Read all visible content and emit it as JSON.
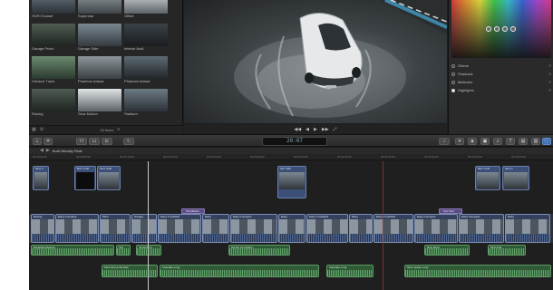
{
  "browser": {
    "clips": [
      {
        "label": "HDRI Sunset"
      },
      {
        "label": "Superstar"
      },
      {
        "label": "Offset"
      },
      {
        "label": "Garage Front"
      },
      {
        "label": "Garage Side"
      },
      {
        "label": "Interior Audi"
      },
      {
        "label": "Outdoor Track"
      },
      {
        "label": "Phantom Ahead"
      },
      {
        "label": "Phantom Ahead"
      },
      {
        "label": "Racing"
      },
      {
        "label": "Slow Motion"
      },
      {
        "label": "Stadium"
      }
    ],
    "count_label": "18 items"
  },
  "viewer": {
    "controls": [
      "◀◀",
      "◀",
      "▶",
      "▶▶",
      "⤢"
    ]
  },
  "inspector": {
    "corrections": [
      {
        "label": "Global",
        "selected": false
      },
      {
        "label": "Shadows",
        "selected": false
      },
      {
        "label": "Midtones",
        "selected": false
      },
      {
        "label": "Highlights",
        "selected": true
      }
    ]
  },
  "toolbar": {
    "timecode": "20:07"
  },
  "timeline": {
    "project_title": "Audi Velocity Final",
    "ruler_ticks": [
      "00:00:00:00",
      "00:00:05:00",
      "00:00:10:00",
      "00:00:15:00",
      "00:00:20:00",
      "00:00:25:00",
      "00:00:30:00",
      "00:00:35:00",
      "00:00:40:00",
      "00:00:45:00",
      "00:00:50:00",
      "00:00:55:00"
    ],
    "connected_clips": [
      {
        "label": "SLO 2"
      },
      {
        "label": "BAY CAR"
      },
      {
        "label": "SLO CAR"
      },
      {
        "label": "SKY 360"
      },
      {
        "label": "BAY CAR"
      },
      {
        "label": "SLO 2"
      }
    ],
    "titles": [
      {
        "label": "Text Below"
      },
      {
        "label": "Text Text"
      }
    ],
    "primary_clips": [
      {
        "label": "Racing"
      },
      {
        "label": "Early Compass"
      },
      {
        "label": "Slow"
      },
      {
        "label": "Garage"
      },
      {
        "label": "Early Crossfield"
      },
      {
        "label": "Early"
      },
      {
        "label": "Early Compass"
      },
      {
        "label": "Early"
      },
      {
        "label": "Early Crossfield"
      },
      {
        "label": "Early"
      },
      {
        "label": "Early Crossfield"
      },
      {
        "label": "Early Compass"
      },
      {
        "label": "Early Compass"
      },
      {
        "label": "Early"
      }
    ],
    "audio_clips": [
      {
        "label": "Breakfast Medium"
      },
      {
        "label": "Into"
      },
      {
        "label": "Jumping In"
      },
      {
        "label": "Synths Up Fading"
      },
      {
        "label": "Ring Race"
      },
      {
        "label": "SFX Drift"
      },
      {
        "label": "Slow Drone Rumble"
      },
      {
        "label": "Cascade Long"
      },
      {
        "label": "Cascade Long"
      },
      {
        "label": "Slow Jessie Long"
      }
    ]
  }
}
